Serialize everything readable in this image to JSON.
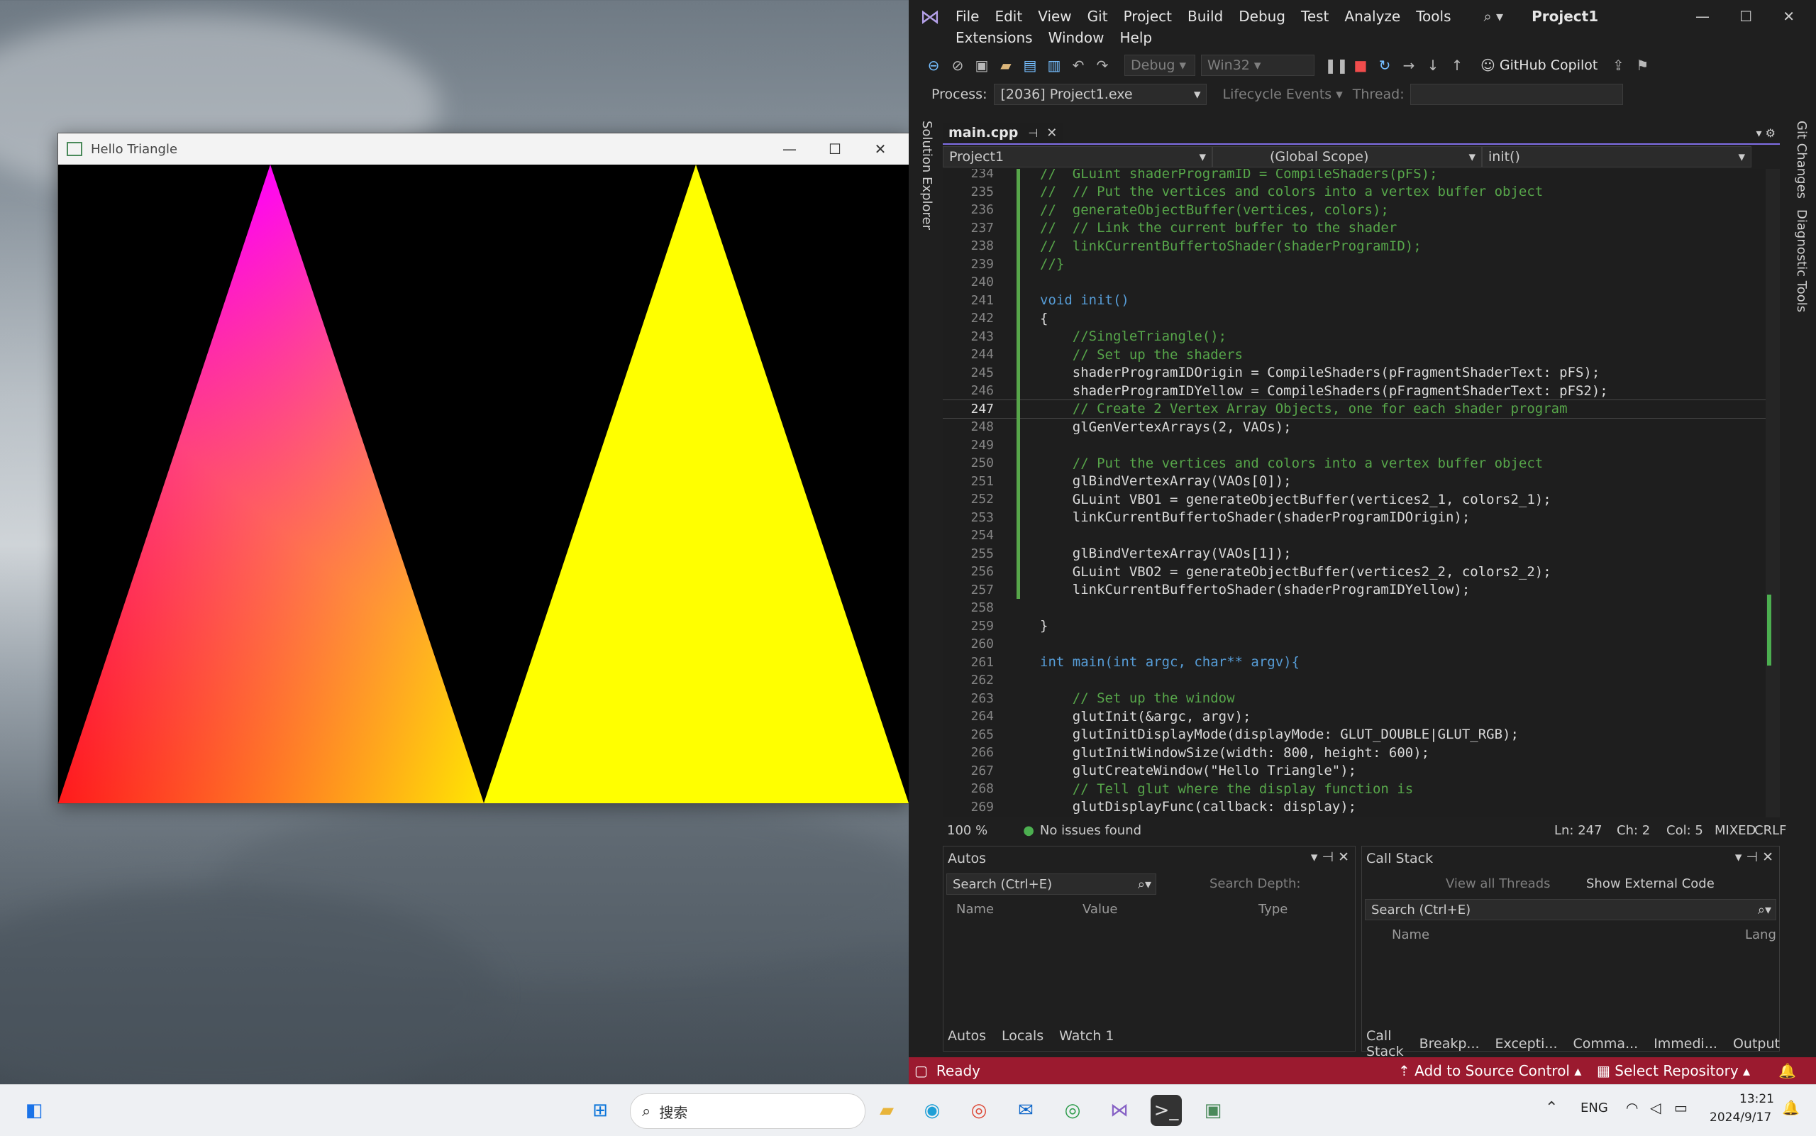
{
  "triangle_window": {
    "title": "Hello Triangle",
    "minimize": "—",
    "maximize": "☐",
    "close": "✕"
  },
  "vs": {
    "menu": [
      "File",
      "Edit",
      "View",
      "Git",
      "Project",
      "Build",
      "Debug",
      "Test",
      "Analyze",
      "Tools"
    ],
    "menu_row2": [
      "Extensions",
      "Window",
      "Help"
    ],
    "project_title": "Project1",
    "toolbar": {
      "config": "Debug",
      "platform": "Win32",
      "copilot": "GitHub Copilot"
    },
    "process_bar": {
      "process_label": "Process:",
      "process_value": "[2036] Project1.exe",
      "lifecycle": "Lifecycle Events",
      "thread_label": "Thread:"
    },
    "side_tabs": {
      "left": "Solution Explorer",
      "right1": "Git Changes",
      "right2": "Diagnostic Tools"
    },
    "doc_tab": "main.cpp",
    "nav": {
      "project": "Project1",
      "scope": "(Global Scope)",
      "member": "init()"
    },
    "code_lines": [
      {
        "n": "234",
        "t": "//  GLuint shaderProgramID = CompileShaders(pFS);"
      },
      {
        "n": "235",
        "t": "//  // Put the vertices and colors into a vertex buffer object"
      },
      {
        "n": "236",
        "t": "//  generateObjectBuffer(vertices, colors);"
      },
      {
        "n": "237",
        "t": "//  // Link the current buffer to the shader"
      },
      {
        "n": "238",
        "t": "//  linkCurrentBuffertoShader(shaderProgramID);"
      },
      {
        "n": "239",
        "t": "//}"
      },
      {
        "n": "240",
        "t": ""
      },
      {
        "n": "241",
        "t": "void init()"
      },
      {
        "n": "242",
        "t": "{"
      },
      {
        "n": "243",
        "t": "    //SingleTriangle();"
      },
      {
        "n": "244",
        "t": "    // Set up the shaders"
      },
      {
        "n": "245",
        "t": "    shaderProgramIDOrigin = CompileShaders(pFragmentShaderText: pFS);"
      },
      {
        "n": "246",
        "t": "    shaderProgramIDYellow = CompileShaders(pFragmentShaderText: pFS2);"
      },
      {
        "n": "247",
        "t": "    // Create 2 Vertex Array Objects, one for each shader program"
      },
      {
        "n": "248",
        "t": "    glGenVertexArrays(2, VAOs);"
      },
      {
        "n": "249",
        "t": ""
      },
      {
        "n": "250",
        "t": "    // Put the vertices and colors into a vertex buffer object"
      },
      {
        "n": "251",
        "t": "    glBindVertexArray(VAOs[0]);"
      },
      {
        "n": "252",
        "t": "    GLuint VBO1 = generateObjectBuffer(vertices2_1, colors2_1);"
      },
      {
        "n": "253",
        "t": "    linkCurrentBuffertoShader(shaderProgramIDOrigin);"
      },
      {
        "n": "254",
        "t": ""
      },
      {
        "n": "255",
        "t": "    glBindVertexArray(VAOs[1]);"
      },
      {
        "n": "256",
        "t": "    GLuint VBO2 = generateObjectBuffer(vertices2_2, colors2_2);"
      },
      {
        "n": "257",
        "t": "    linkCurrentBuffertoShader(shaderProgramIDYellow);"
      },
      {
        "n": "258",
        "t": ""
      },
      {
        "n": "259",
        "t": "}"
      },
      {
        "n": "260",
        "t": ""
      },
      {
        "n": "261",
        "t": "int main(int argc, char** argv){"
      },
      {
        "n": "262",
        "t": ""
      },
      {
        "n": "263",
        "t": "    // Set up the window"
      },
      {
        "n": "264",
        "t": "    glutInit(&argc, argv);"
      },
      {
        "n": "265",
        "t": "    glutInitDisplayMode(displayMode: GLUT_DOUBLE|GLUT_RGB);"
      },
      {
        "n": "266",
        "t": "    glutInitWindowSize(width: 800, height: 600);"
      },
      {
        "n": "267",
        "t": "    glutCreateWindow(\"Hello Triangle\");"
      },
      {
        "n": "268",
        "t": "    // Tell glut where the display function is"
      },
      {
        "n": "269",
        "t": "    glutDisplayFunc(callback: display);"
      }
    ],
    "status_editor": {
      "zoom": "100 %",
      "issues": "No issues found",
      "ln": "Ln: 247",
      "ch": "Ch: 2",
      "col": "Col: 5",
      "tabs": "MIXED",
      "eol": "CRLF"
    },
    "autos": {
      "title": "Autos",
      "search_placeholder": "Search (Ctrl+E)",
      "depth_label": "Search Depth:",
      "cols": [
        "Name",
        "Value",
        "Type"
      ],
      "tabs": [
        "Autos",
        "Locals",
        "Watch 1"
      ]
    },
    "callstack": {
      "title": "Call Stack",
      "view_threads": "View all Threads",
      "show_external": "Show External Code",
      "search_placeholder": "Search (Ctrl+E)",
      "cols": [
        "Name",
        "Lang"
      ],
      "tabs": [
        "Call Stack",
        "Breakp...",
        "Excepti...",
        "Comma...",
        "Immedi...",
        "Output"
      ]
    },
    "statusbar": {
      "ready": "Ready",
      "source_control": "Add to Source Control",
      "repo": "Select Repository",
      "color": "#9b1a2f"
    }
  },
  "taskbar": {
    "search": "搜索",
    "lang": "ENG",
    "time": "13:21",
    "date": "2024/9/17"
  }
}
